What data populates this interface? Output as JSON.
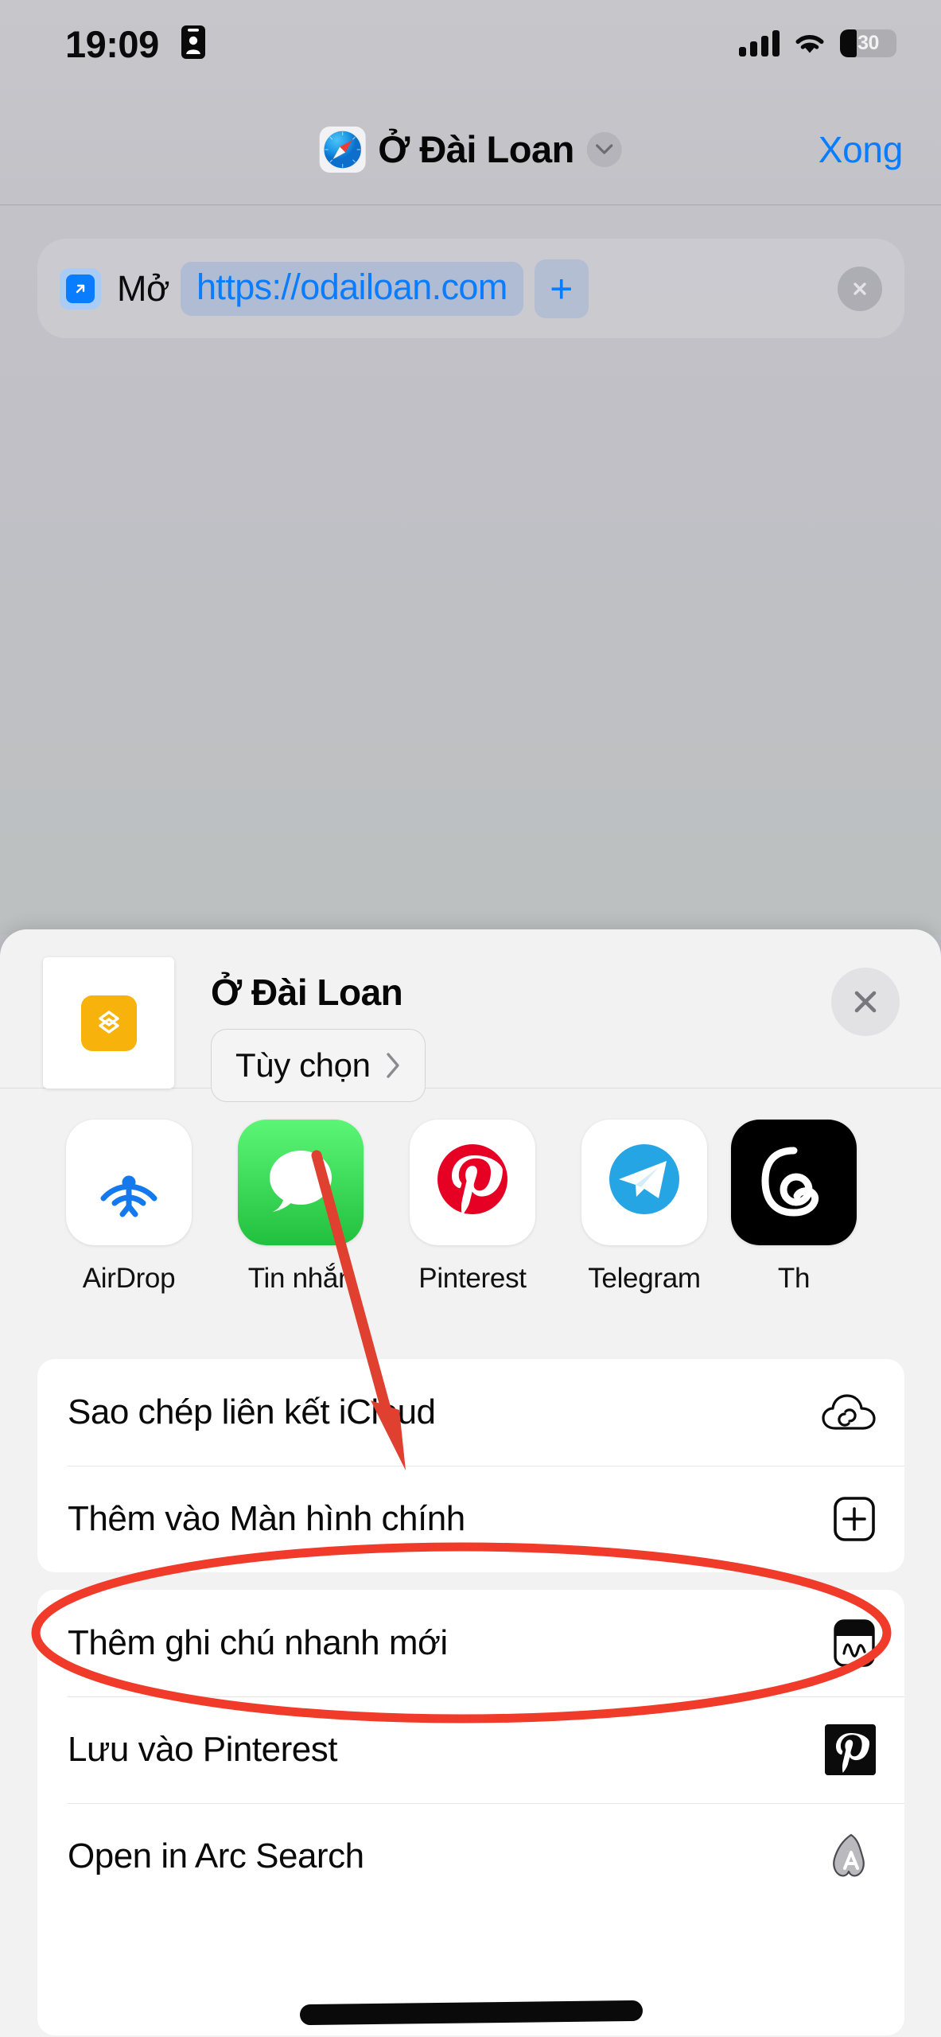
{
  "status_bar": {
    "time": "19:09",
    "contact_icon": "contact-card-icon",
    "cellular_icon": "cellular-signal-icon",
    "wifi_icon": "wifi-icon",
    "battery_percent": "30"
  },
  "nav_bar": {
    "app_icon": "safari-compass-icon",
    "title": "Ở Đài Loan",
    "chevron_icon": "chevron-down-icon",
    "done_label": "Xong"
  },
  "action_card": {
    "open_icon": "arrow-up-right-square-icon",
    "verb": "Mở",
    "url": "https://odailoan.com",
    "add_label": "+",
    "remove_icon": "close-circle-icon"
  },
  "share_sheet": {
    "thumbnail_icon": "stacked-layers-icon",
    "title": "Ở Đài Loan",
    "options_label": "Tùy chọn",
    "options_chevron": "chevron-right-icon",
    "close_icon": "close-icon",
    "apps": [
      {
        "label": "AirDrop",
        "icon": "airdrop-icon",
        "bg": "#FFFFFF"
      },
      {
        "label": "Tin nhắn",
        "icon": "messages-icon",
        "bg": "#34C759"
      },
      {
        "label": "Pinterest",
        "icon": "pinterest-icon",
        "bg": "#FFFFFF"
      },
      {
        "label": "Telegram",
        "icon": "telegram-icon",
        "bg": "#FFFFFF"
      },
      {
        "label": "Th",
        "icon": "threads-icon",
        "bg": "#000000"
      }
    ],
    "groups": [
      {
        "rows": [
          {
            "label": "Sao chép liên kết iCloud",
            "icon": "icloud-link-icon"
          },
          {
            "label": "Thêm vào Màn hình chính",
            "icon": "add-to-home-screen-icon"
          }
        ]
      },
      {
        "rows": [
          {
            "label": "Thêm ghi chú nhanh mới",
            "icon": "quick-note-icon"
          },
          {
            "label": "Lưu vào Pinterest",
            "icon": "pinterest-square-icon"
          },
          {
            "label": "Open in Arc Search",
            "icon": "arc-search-icon"
          }
        ]
      }
    ]
  },
  "annotations": {
    "arrow_color": "#E0402F",
    "ellipse_color": "#F03A2A",
    "redaction_color": "#0A0A0A"
  }
}
